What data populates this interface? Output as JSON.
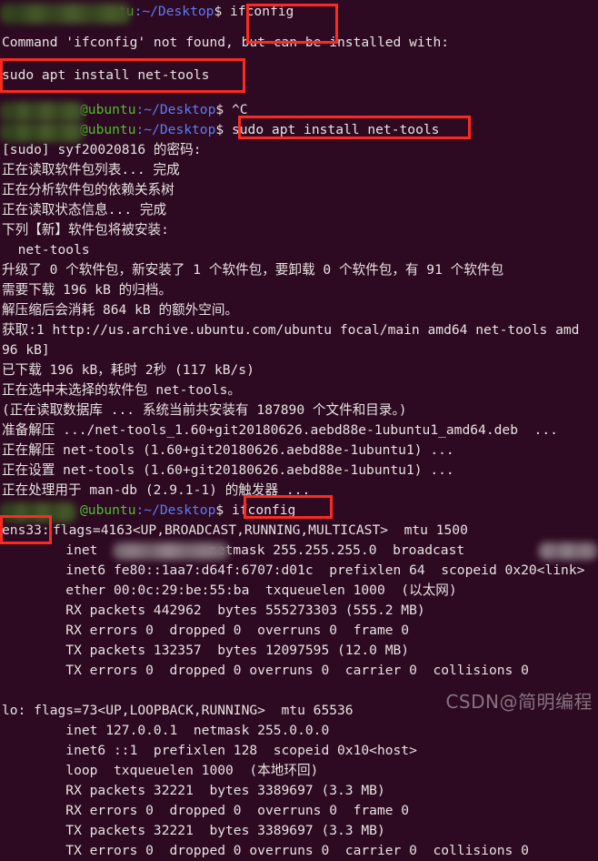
{
  "terminal": {
    "background_color": "#2D0922",
    "foreground_color": "#E8E3E3",
    "prompt_user_color": "#4FBF2F",
    "prompt_path_color": "#5C7CF5",
    "highlight_box_color": "#FC2A21",
    "prompt": {
      "host": "@ubuntu",
      "host_short": "tu",
      "path": ":~/Desktop",
      "symbol": "$"
    },
    "lines": [
      {
        "id": 0,
        "text": "ifconfig"
      },
      {
        "id": 1,
        "text": "Command 'ifconfig' not found, but can be installed with:"
      },
      {
        "id": 2,
        "text": "sudo apt install net-tools"
      },
      {
        "id": 3,
        "text": "^C"
      },
      {
        "id": 4,
        "text": "sudo apt install net-tools"
      },
      {
        "id": 5,
        "text": "[sudo] syf20020816 的密码:"
      },
      {
        "id": 6,
        "text": "正在读取软件包列表... 完成"
      },
      {
        "id": 7,
        "text": "正在分析软件包的依赖关系树"
      },
      {
        "id": 8,
        "text": "正在读取状态信息... 完成"
      },
      {
        "id": 9,
        "text": "下列【新】软件包将被安装:"
      },
      {
        "id": 10,
        "text": "  net-tools"
      },
      {
        "id": 11,
        "text": "升级了 0 个软件包，新安装了 1 个软件包，要卸载 0 个软件包，有 91 个软件包"
      },
      {
        "id": 12,
        "text": "需要下载 196 kB 的归档。"
      },
      {
        "id": 13,
        "text": "解压缩后会消耗 864 kB 的额外空间。"
      },
      {
        "id": 14,
        "text": "获取:1 http://us.archive.ubuntu.com/ubuntu focal/main amd64 net-tools amd"
      },
      {
        "id": 15,
        "text": "96 kB]"
      },
      {
        "id": 16,
        "text": "已下载 196 kB，耗时 2秒 (117 kB/s)"
      },
      {
        "id": 17,
        "text": "正在选中未选择的软件包 net-tools。"
      },
      {
        "id": 18,
        "text": "(正在读取数据库 ... 系统当前共安装有 187890 个文件和目录。)"
      },
      {
        "id": 19,
        "text": "准备解压 .../net-tools_1.60+git20180626.aebd88e-1ubuntu1_amd64.deb  ..."
      },
      {
        "id": 20,
        "text": "正在解压 net-tools (1.60+git20180626.aebd88e-1ubuntu1) ..."
      },
      {
        "id": 21,
        "text": "正在设置 net-tools (1.60+git20180626.aebd88e-1ubuntu1) ..."
      },
      {
        "id": 22,
        "text": "正在处理用于 man-db (2.9.1-1) 的触发器 ..."
      },
      {
        "id": 23,
        "text": "ifconfig"
      },
      {
        "id": 24,
        "text": "ens33:"
      },
      {
        "id": 25,
        "text": "flags=4163<UP,BROADCAST,RUNNING,MULTICAST>  mtu 1500"
      },
      {
        "id": 26,
        "text": "        inet "
      },
      {
        "id": 27,
        "text": "netmask 255.255.255.0  broadcast"
      },
      {
        "id": 28,
        "text": "        inet6 fe80::1aa7:d64f:6707:d01c  prefixlen 64  scopeid 0x20<link>"
      },
      {
        "id": 29,
        "text": "        ether 00:0c:29:be:55:ba  txqueuelen 1000  (以太网)"
      },
      {
        "id": 30,
        "text": "        RX packets 442962  bytes 555273303 (555.2 MB)"
      },
      {
        "id": 31,
        "text": "        RX errors 0  dropped 0  overruns 0  frame 0"
      },
      {
        "id": 32,
        "text": "        TX packets 132357  bytes 12097595 (12.0 MB)"
      },
      {
        "id": 33,
        "text": "        TX errors 0  dropped 0 overruns 0  carrier 0  collisions 0"
      },
      {
        "id": 34,
        "text": "lo: flags=73<UP,LOOPBACK,RUNNING>  mtu 65536"
      },
      {
        "id": 35,
        "text": "        inet 127.0.0.1  netmask 255.0.0.0"
      },
      {
        "id": 36,
        "text": "        inet6 ::1  prefixlen 128  scopeid 0x10<host>"
      },
      {
        "id": 37,
        "text": "        loop  txqueuelen 1000  (本地环回)"
      },
      {
        "id": 38,
        "text": "        RX packets 32221  bytes 3389697 (3.3 MB)"
      },
      {
        "id": 39,
        "text": "        RX errors 0  dropped 0  overruns 0  frame 0"
      },
      {
        "id": 40,
        "text": "        TX packets 32221  bytes 3389697 (3.3 MB)"
      },
      {
        "id": 41,
        "text": "        TX errors 0  dropped 0 overruns 0  carrier 0  collisions 0"
      }
    ]
  },
  "watermark": {
    "brand": "CSDN",
    "author": "@简明编程"
  }
}
